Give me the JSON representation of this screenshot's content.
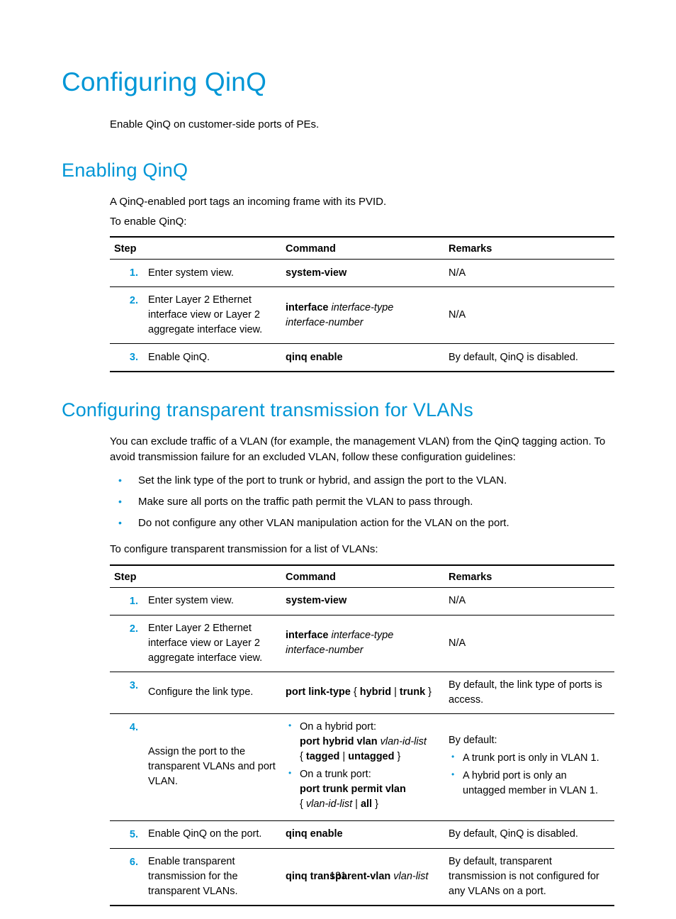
{
  "h1": "Configuring QinQ",
  "intro1": "Enable QinQ on customer-side ports of PEs.",
  "h2a": "Enabling QinQ",
  "p1": "A QinQ-enabled port tags an incoming frame with its PVID.",
  "p2": "To enable QinQ:",
  "table1": {
    "head": {
      "step": "Step",
      "command": "Command",
      "remarks": "Remarks"
    },
    "rows": [
      {
        "num": "1.",
        "step": "Enter system view.",
        "cmd_bold": "system-view",
        "rem": "N/A"
      },
      {
        "num": "2.",
        "step": "Enter Layer 2 Ethernet interface view or Layer 2 aggregate interface view.",
        "cmd_bold": "interface",
        "cmd_ital1": "interface-type",
        "cmd_ital2": "interface-number",
        "rem": "N/A"
      },
      {
        "num": "3.",
        "step": "Enable QinQ.",
        "cmd_bold": "qinq enable",
        "rem": "By default, QinQ is disabled."
      }
    ]
  },
  "h2b": "Configuring transparent transmission for VLANs",
  "p3": "You can exclude traffic of a VLAN (for example, the management VLAN) from the QinQ tagging action. To avoid transmission failure for an excluded VLAN, follow these configuration guidelines:",
  "bullets1": [
    "Set the link type of the port to trunk or hybrid, and assign the port to the VLAN.",
    "Make sure all ports on the traffic path permit the VLAN to pass through.",
    "Do not configure any other VLAN manipulation action for the VLAN on the port."
  ],
  "p4": "To configure transparent transmission for a list of VLANs:",
  "table2": {
    "head": {
      "step": "Step",
      "command": "Command",
      "remarks": "Remarks"
    },
    "rows": {
      "r1": {
        "num": "1.",
        "step": "Enter system view.",
        "cmd_bold": "system-view",
        "rem": "N/A"
      },
      "r2": {
        "num": "2.",
        "step": "Enter Layer 2 Ethernet interface view or Layer 2 aggregate interface view.",
        "cmd_bold": "interface",
        "cmd_ital1": "interface-type",
        "cmd_ital2": "interface-number",
        "rem": "N/A"
      },
      "r3": {
        "num": "3.",
        "step": "Configure the link type.",
        "cmd_b1": "port link-type",
        "cmd_t1": " { ",
        "cmd_b2": "hybrid",
        "cmd_t2": " | ",
        "cmd_b3": "trunk",
        "cmd_t3": " }",
        "rem": "By default, the link type of ports is access."
      },
      "r4": {
        "num": "4.",
        "step": "Assign the port to the transparent VLANs and port VLAN.",
        "li1_lead": "On a hybrid port:",
        "li1_b1": "port hybrid vlan",
        "li1_i1": "vlan-id-list",
        "li1_t1": "{ ",
        "li1_b2": "tagged",
        "li1_t2": " | ",
        "li1_b3": "untagged",
        "li1_t3": " }",
        "li2_lead": "On a trunk port:",
        "li2_b1": "port trunk permit vlan",
        "li2_t1": "{ ",
        "li2_i1": "vlan-id-list",
        "li2_t2": " | ",
        "li2_b2": "all",
        "li2_t3": " }",
        "rem_lead": "By default:",
        "rem_b1": "A trunk port is only in VLAN 1.",
        "rem_b2": "A hybrid port is only an untagged member in VLAN 1."
      },
      "r5": {
        "num": "5.",
        "step": "Enable QinQ on the port.",
        "cmd_bold": "qinq enable",
        "rem": "By default, QinQ is disabled."
      },
      "r6": {
        "num": "6.",
        "step": "Enable transparent transmission for the transparent VLANs.",
        "cmd_b1": "qinq transparent-vlan",
        "cmd_i1": "vlan-list",
        "rem": "By default, transparent transmission is not configured for any VLANs on a port."
      }
    }
  },
  "pagenum": "131"
}
